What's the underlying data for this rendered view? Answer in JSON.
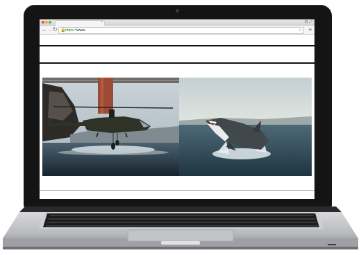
{
  "browser": {
    "url_scheme": "https://",
    "url_host": "www."
  },
  "images": [
    {
      "name": "helicopter-photo",
      "alt": ""
    },
    {
      "name": "shark-photo",
      "alt": ""
    }
  ],
  "colors": {
    "bezel": "#141414",
    "secure_green": "#1a7f2c"
  }
}
